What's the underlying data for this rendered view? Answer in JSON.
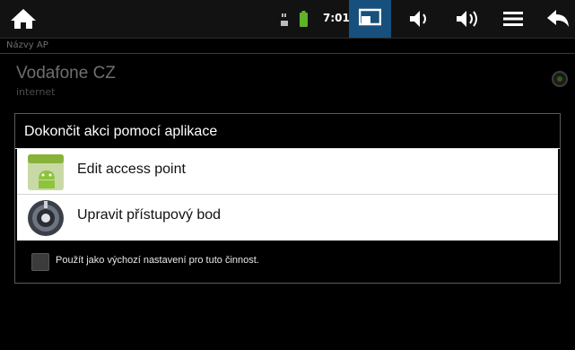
{
  "status_bar": {
    "time": "7:01",
    "icons": [
      "home-icon",
      "sim-signal-icon",
      "battery-icon",
      "screen-icon",
      "volume-down-icon",
      "volume-up-icon",
      "menu-icon",
      "back-icon"
    ],
    "colors": {
      "background": "#121212",
      "highlight": "#17507c",
      "battery": "#5fb32c"
    }
  },
  "background": {
    "section_header": "Názvy AP",
    "ap_item": {
      "name": "Vodafone CZ",
      "subtitle": "internet"
    }
  },
  "dialog": {
    "title": "Dokončit akci pomocí aplikace",
    "options": [
      {
        "label": "Edit access point",
        "icon": "android-market-icon"
      },
      {
        "label": "Upravit přístupový bod",
        "icon": "settings-app-icon"
      }
    ],
    "default_checkbox": {
      "label": "Použít jako výchozí nastavení pro tuto činnost.",
      "checked": false
    }
  }
}
